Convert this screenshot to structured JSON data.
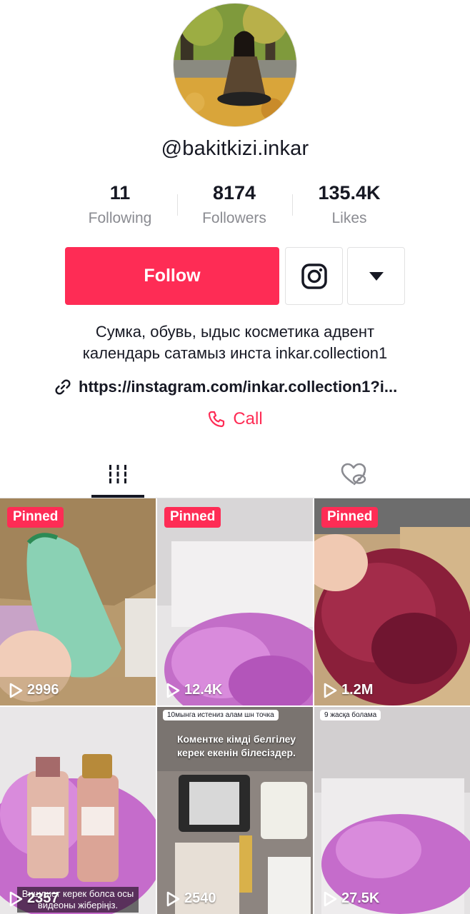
{
  "profile": {
    "username": "@bakitkizi.inkar",
    "stats": [
      {
        "value": "11",
        "label": "Following"
      },
      {
        "value": "8174",
        "label": "Followers"
      },
      {
        "value": "135.4K",
        "label": "Likes"
      }
    ],
    "follow_label": "Follow",
    "bio_line1": "Сумка, обувь, ыдыс косметика адвент",
    "bio_line2": "календарь сатамыз инста inkar.collection1",
    "link": "https://instagram.com/inkar.collection1?i...",
    "call_label": "Call"
  },
  "tabs": [
    {
      "icon": "grid-icon",
      "active": true
    },
    {
      "icon": "liked-hidden-icon",
      "active": false
    }
  ],
  "colors": {
    "accent": "#fe2c55",
    "text": "#161823",
    "muted": "#8a8b91"
  },
  "videos": [
    {
      "pinned_label": "Pinned",
      "views": "2996"
    },
    {
      "pinned_label": "Pinned",
      "views": "12.4K"
    },
    {
      "pinned_label": "Pinned",
      "views": "1.2M"
    },
    {
      "views": "2357",
      "caption": "Вишлист керек болса осы видеоны жіберіңіз."
    },
    {
      "views": "2540",
      "comment": "10мынга истениз алам шн точка",
      "overlay": "Коментке кімді белгілеу керек екенін білесіздер."
    },
    {
      "views": "27.5K",
      "comment": "9 жасқа болама"
    }
  ]
}
